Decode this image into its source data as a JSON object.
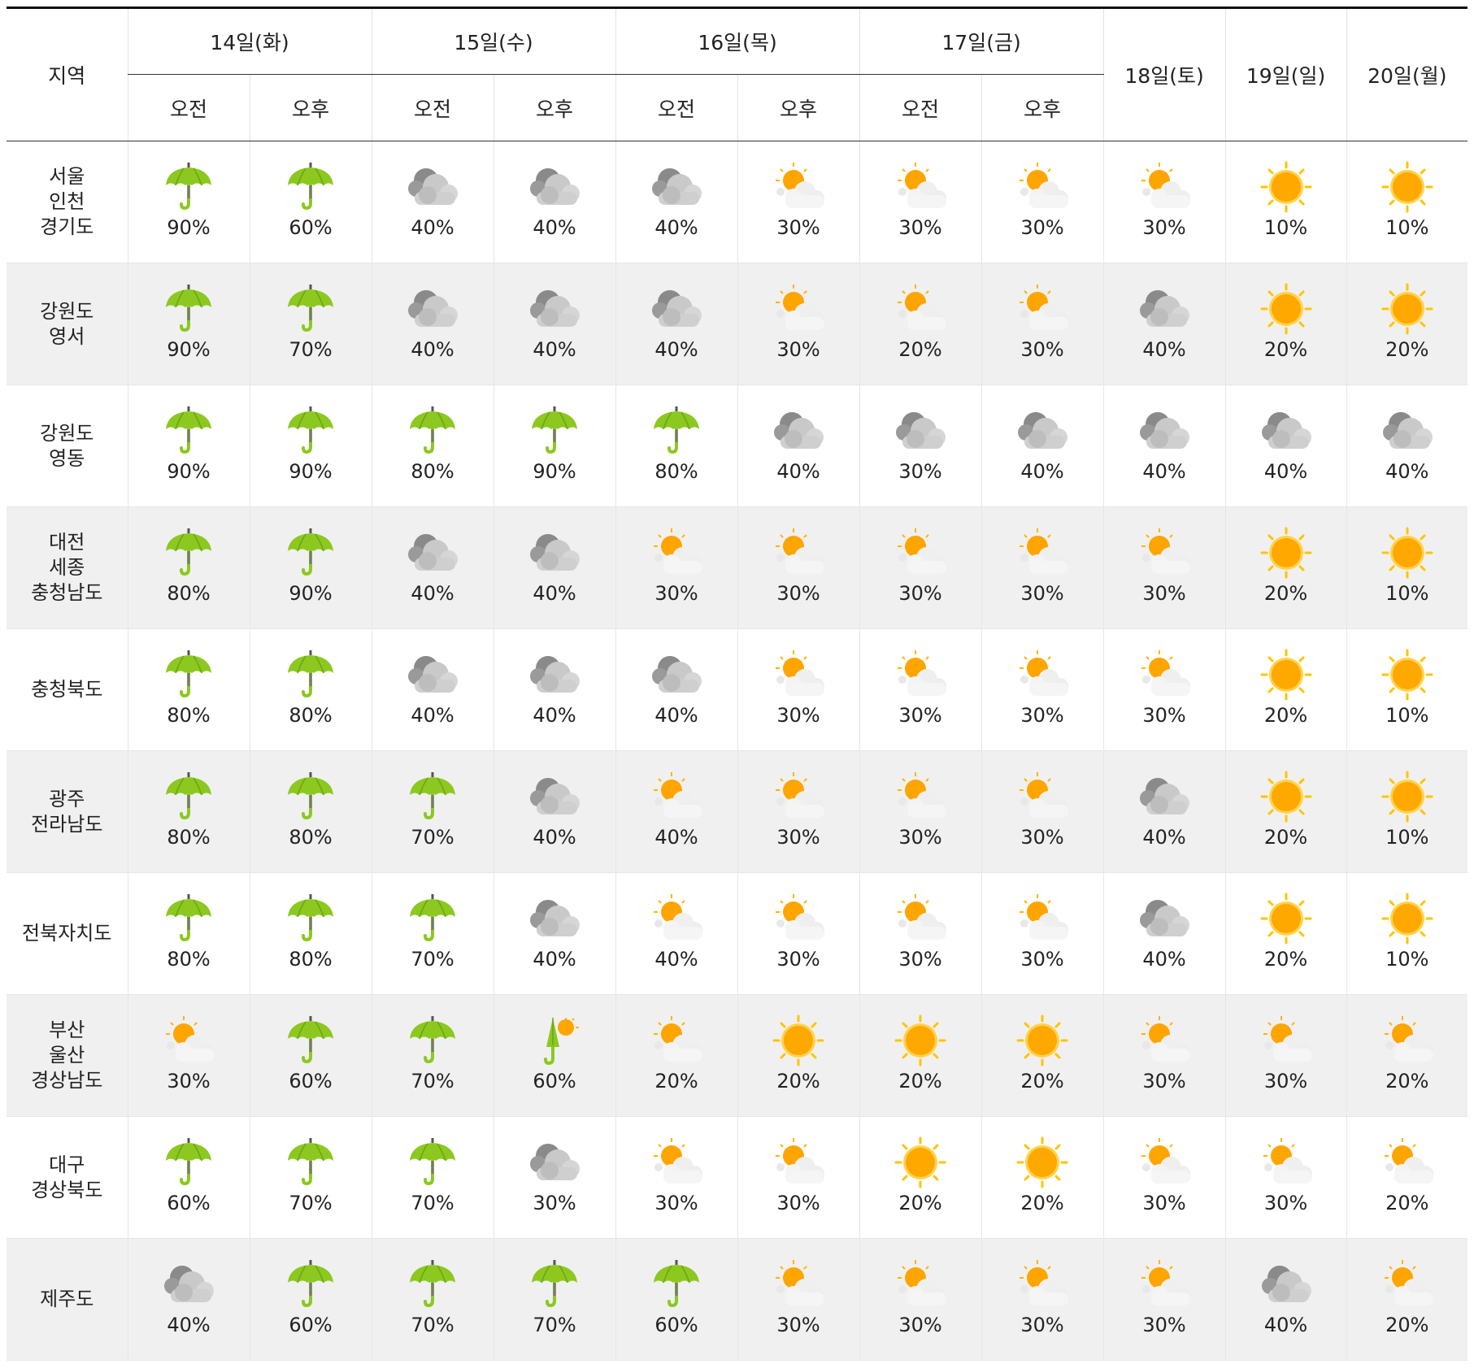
{
  "header": {
    "region_label": "지역",
    "split_days": [
      "14일(화)",
      "15일(수)",
      "16일(목)",
      "17일(금)"
    ],
    "full_days": [
      "18일(토)",
      "19일(일)",
      "20일(월)"
    ],
    "am_label": "오전",
    "pm_label": "오후"
  },
  "icon_names": {
    "rain": "umbrella-icon",
    "cloudy": "cloud-icon",
    "partly_cloudy": "sun-behind-cloud-icon",
    "sunny": "sun-icon",
    "shower": "closed-umbrella-sun-icon"
  },
  "colors": {
    "umbrella": "#86c61a",
    "sun": "#ffab00",
    "cloud": "#c8c8c8",
    "alt_row": "#f0f0f0"
  },
  "rows": [
    {
      "region": [
        "서울",
        "인천",
        "경기도"
      ],
      "cells": [
        {
          "icon": "rain",
          "pct": "90%"
        },
        {
          "icon": "rain",
          "pct": "60%"
        },
        {
          "icon": "cloudy",
          "pct": "40%"
        },
        {
          "icon": "cloudy",
          "pct": "40%"
        },
        {
          "icon": "cloudy",
          "pct": "40%"
        },
        {
          "icon": "partly_cloudy",
          "pct": "30%"
        },
        {
          "icon": "partly_cloudy",
          "pct": "30%"
        },
        {
          "icon": "partly_cloudy",
          "pct": "30%"
        },
        {
          "icon": "partly_cloudy",
          "pct": "30%"
        },
        {
          "icon": "sunny",
          "pct": "10%"
        },
        {
          "icon": "sunny",
          "pct": "10%"
        }
      ]
    },
    {
      "region": [
        "강원도",
        "영서"
      ],
      "cells": [
        {
          "icon": "rain",
          "pct": "90%"
        },
        {
          "icon": "rain",
          "pct": "70%"
        },
        {
          "icon": "cloudy",
          "pct": "40%"
        },
        {
          "icon": "cloudy",
          "pct": "40%"
        },
        {
          "icon": "cloudy",
          "pct": "40%"
        },
        {
          "icon": "partly_cloudy",
          "pct": "30%"
        },
        {
          "icon": "partly_cloudy",
          "pct": "20%"
        },
        {
          "icon": "partly_cloudy",
          "pct": "30%"
        },
        {
          "icon": "cloudy",
          "pct": "40%"
        },
        {
          "icon": "sunny",
          "pct": "20%"
        },
        {
          "icon": "sunny",
          "pct": "20%"
        }
      ]
    },
    {
      "region": [
        "강원도",
        "영동"
      ],
      "cells": [
        {
          "icon": "rain",
          "pct": "90%"
        },
        {
          "icon": "rain",
          "pct": "90%"
        },
        {
          "icon": "rain",
          "pct": "80%"
        },
        {
          "icon": "rain",
          "pct": "90%"
        },
        {
          "icon": "rain",
          "pct": "80%"
        },
        {
          "icon": "cloudy",
          "pct": "40%"
        },
        {
          "icon": "cloudy",
          "pct": "30%"
        },
        {
          "icon": "cloudy",
          "pct": "40%"
        },
        {
          "icon": "cloudy",
          "pct": "40%"
        },
        {
          "icon": "cloudy",
          "pct": "40%"
        },
        {
          "icon": "cloudy",
          "pct": "40%"
        }
      ]
    },
    {
      "region": [
        "대전",
        "세종",
        "충청남도"
      ],
      "cells": [
        {
          "icon": "rain",
          "pct": "80%"
        },
        {
          "icon": "rain",
          "pct": "90%"
        },
        {
          "icon": "cloudy",
          "pct": "40%"
        },
        {
          "icon": "cloudy",
          "pct": "40%"
        },
        {
          "icon": "partly_cloudy",
          "pct": "30%"
        },
        {
          "icon": "partly_cloudy",
          "pct": "30%"
        },
        {
          "icon": "partly_cloudy",
          "pct": "30%"
        },
        {
          "icon": "partly_cloudy",
          "pct": "30%"
        },
        {
          "icon": "partly_cloudy",
          "pct": "30%"
        },
        {
          "icon": "sunny",
          "pct": "20%"
        },
        {
          "icon": "sunny",
          "pct": "10%"
        }
      ]
    },
    {
      "region": [
        "충청북도"
      ],
      "cells": [
        {
          "icon": "rain",
          "pct": "80%"
        },
        {
          "icon": "rain",
          "pct": "80%"
        },
        {
          "icon": "cloudy",
          "pct": "40%"
        },
        {
          "icon": "cloudy",
          "pct": "40%"
        },
        {
          "icon": "cloudy",
          "pct": "40%"
        },
        {
          "icon": "partly_cloudy",
          "pct": "30%"
        },
        {
          "icon": "partly_cloudy",
          "pct": "30%"
        },
        {
          "icon": "partly_cloudy",
          "pct": "30%"
        },
        {
          "icon": "partly_cloudy",
          "pct": "30%"
        },
        {
          "icon": "sunny",
          "pct": "20%"
        },
        {
          "icon": "sunny",
          "pct": "10%"
        }
      ]
    },
    {
      "region": [
        "광주",
        "전라남도"
      ],
      "cells": [
        {
          "icon": "rain",
          "pct": "80%"
        },
        {
          "icon": "rain",
          "pct": "80%"
        },
        {
          "icon": "rain",
          "pct": "70%"
        },
        {
          "icon": "cloudy",
          "pct": "40%"
        },
        {
          "icon": "partly_cloudy",
          "pct": "40%"
        },
        {
          "icon": "partly_cloudy",
          "pct": "30%"
        },
        {
          "icon": "partly_cloudy",
          "pct": "30%"
        },
        {
          "icon": "partly_cloudy",
          "pct": "30%"
        },
        {
          "icon": "cloudy",
          "pct": "40%"
        },
        {
          "icon": "sunny",
          "pct": "20%"
        },
        {
          "icon": "sunny",
          "pct": "10%"
        }
      ]
    },
    {
      "region": [
        "전북자치도"
      ],
      "cells": [
        {
          "icon": "rain",
          "pct": "80%"
        },
        {
          "icon": "rain",
          "pct": "80%"
        },
        {
          "icon": "rain",
          "pct": "70%"
        },
        {
          "icon": "cloudy",
          "pct": "40%"
        },
        {
          "icon": "partly_cloudy",
          "pct": "40%"
        },
        {
          "icon": "partly_cloudy",
          "pct": "30%"
        },
        {
          "icon": "partly_cloudy",
          "pct": "30%"
        },
        {
          "icon": "partly_cloudy",
          "pct": "30%"
        },
        {
          "icon": "cloudy",
          "pct": "40%"
        },
        {
          "icon": "sunny",
          "pct": "20%"
        },
        {
          "icon": "sunny",
          "pct": "10%"
        }
      ]
    },
    {
      "region": [
        "부산",
        "울산",
        "경상남도"
      ],
      "cells": [
        {
          "icon": "partly_cloudy",
          "pct": "30%"
        },
        {
          "icon": "rain",
          "pct": "60%"
        },
        {
          "icon": "rain",
          "pct": "70%"
        },
        {
          "icon": "shower",
          "pct": "60%"
        },
        {
          "icon": "partly_cloudy",
          "pct": "20%"
        },
        {
          "icon": "sunny",
          "pct": "20%"
        },
        {
          "icon": "sunny",
          "pct": "20%"
        },
        {
          "icon": "sunny",
          "pct": "20%"
        },
        {
          "icon": "partly_cloudy",
          "pct": "30%"
        },
        {
          "icon": "partly_cloudy",
          "pct": "30%"
        },
        {
          "icon": "partly_cloudy",
          "pct": "20%"
        }
      ]
    },
    {
      "region": [
        "대구",
        "경상북도"
      ],
      "cells": [
        {
          "icon": "rain",
          "pct": "60%"
        },
        {
          "icon": "rain",
          "pct": "70%"
        },
        {
          "icon": "rain",
          "pct": "70%"
        },
        {
          "icon": "cloudy",
          "pct": "30%"
        },
        {
          "icon": "partly_cloudy",
          "pct": "30%"
        },
        {
          "icon": "partly_cloudy",
          "pct": "30%"
        },
        {
          "icon": "sunny",
          "pct": "20%"
        },
        {
          "icon": "sunny",
          "pct": "20%"
        },
        {
          "icon": "partly_cloudy",
          "pct": "30%"
        },
        {
          "icon": "partly_cloudy",
          "pct": "30%"
        },
        {
          "icon": "partly_cloudy",
          "pct": "20%"
        }
      ]
    },
    {
      "region": [
        "제주도"
      ],
      "cells": [
        {
          "icon": "cloudy",
          "pct": "40%"
        },
        {
          "icon": "rain",
          "pct": "60%"
        },
        {
          "icon": "rain",
          "pct": "70%"
        },
        {
          "icon": "rain",
          "pct": "70%"
        },
        {
          "icon": "rain",
          "pct": "60%"
        },
        {
          "icon": "partly_cloudy",
          "pct": "30%"
        },
        {
          "icon": "partly_cloudy",
          "pct": "30%"
        },
        {
          "icon": "partly_cloudy",
          "pct": "30%"
        },
        {
          "icon": "partly_cloudy",
          "pct": "30%"
        },
        {
          "icon": "cloudy",
          "pct": "40%"
        },
        {
          "icon": "partly_cloudy",
          "pct": "20%"
        }
      ]
    }
  ]
}
